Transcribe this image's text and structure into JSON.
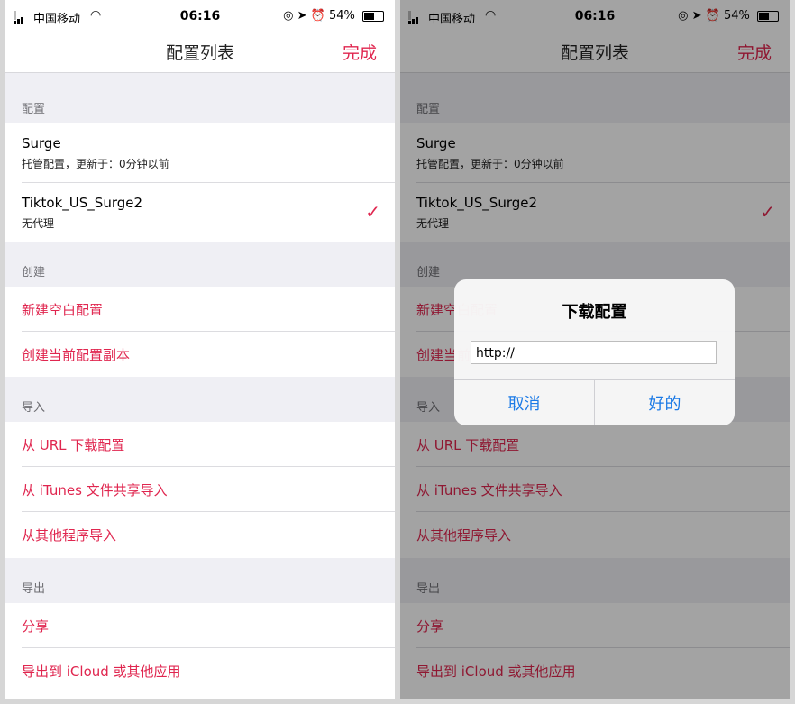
{
  "status_bar": {
    "carrier": "中国移动",
    "time": "06:16",
    "battery": "54%",
    "battery_level": 0.54
  },
  "nav": {
    "title": "配置列表",
    "done": "完成"
  },
  "sections": {
    "config": {
      "header": "配置",
      "items": [
        {
          "name": "Surge",
          "detail": "托管配置，更新于：0分钟以前",
          "selected": false
        },
        {
          "name": "Tiktok_US_Surge2",
          "detail": "无代理",
          "selected": true
        }
      ],
      "checkmark": "✓"
    },
    "create": {
      "header": "创建",
      "items": [
        "新建空白配置",
        "创建当前配置副本"
      ]
    },
    "import": {
      "header": "导入",
      "items": [
        "从 URL 下载配置",
        "从 iTunes 文件共享导入",
        "从其他程序导入"
      ]
    },
    "export": {
      "header": "导出",
      "items": [
        "分享",
        "导出到 iCloud 或其他应用"
      ]
    }
  },
  "alert": {
    "title": "下载配置",
    "field_value": "http://",
    "cancel": "取消",
    "ok": "好的"
  },
  "colors": {
    "accent": "#e0264f",
    "link_blue": "#1b7ae6",
    "background": "#efeff4"
  }
}
